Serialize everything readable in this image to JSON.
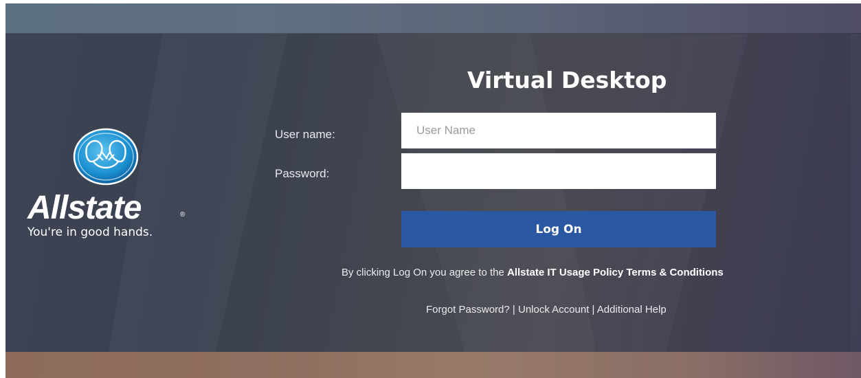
{
  "brand": {
    "name": "Allstate",
    "tagline": "You're in good hands.",
    "registered_mark": "®",
    "logo_icon": "cupped-hands-icon",
    "logo_color": "#1a8fd0"
  },
  "page": {
    "title": "Virtual Desktop"
  },
  "form": {
    "username_label": "User name:",
    "username_placeholder": "User Name",
    "username_value": "",
    "password_label": "Password:",
    "password_value": "",
    "submit_label": "Log On",
    "submit_color": "#2b58a3"
  },
  "agreement": {
    "prefix": "By clicking Log On you agree to the ",
    "link": "Allstate IT Usage Policy Terms & Conditions"
  },
  "help_links": {
    "forgot_password": "Forgot Password?",
    "unlock_account": "Unlock Account",
    "additional_help": "Additional Help",
    "separator": "|"
  }
}
